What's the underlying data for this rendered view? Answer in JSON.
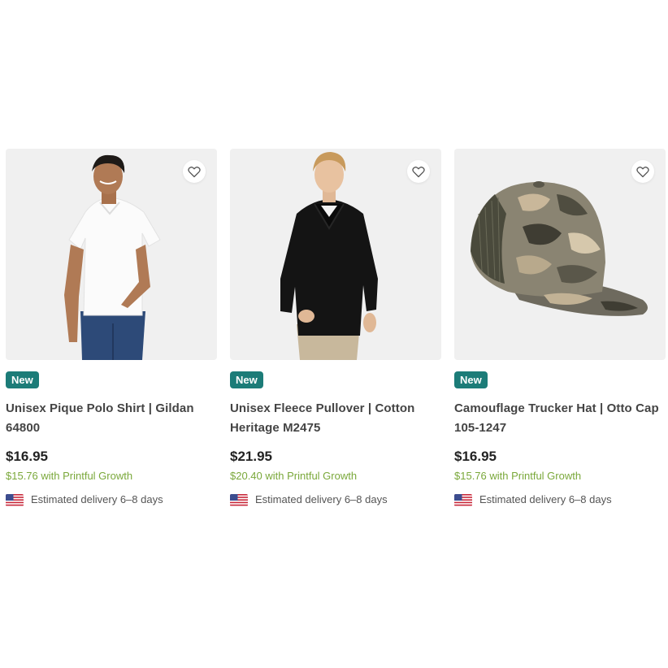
{
  "products": [
    {
      "badge": "New",
      "title": "Unisex Pique Polo Shirt | Gildan 64800",
      "price": "$16.95",
      "growth_price": "$15.76 with Printful Growth",
      "delivery": "Estimated delivery 6–8 days",
      "image": "white-polo-shirt-model"
    },
    {
      "badge": "New",
      "title": "Unisex Fleece Pullover | Cotton Heritage M2475",
      "price": "$21.95",
      "growth_price": "$20.40 with Printful Growth",
      "delivery": "Estimated delivery 6–8 days",
      "image": "black-fleece-pullover-model"
    },
    {
      "badge": "New",
      "title": "Camouflage Trucker Hat | Otto Cap 105-1247",
      "price": "$16.95",
      "growth_price": "$15.76 with Printful Growth",
      "delivery": "Estimated delivery 6–8 days",
      "image": "camouflage-trucker-hat"
    }
  ],
  "icons": {
    "favorite": "heart-icon",
    "flag": "us-flag-icon"
  },
  "colors": {
    "badge_bg": "#1c7c78",
    "growth_text": "#7aa83a",
    "thumb_bg": "#f0f0f0"
  }
}
